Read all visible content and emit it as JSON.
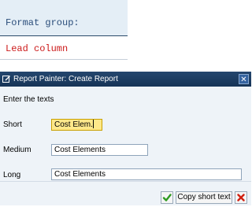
{
  "format_panel": {
    "format_group_label": "Format group:",
    "lead_column_text": "Lead column"
  },
  "dialog": {
    "title": "Report Painter: Create Report",
    "close_glyph": "✕",
    "intro": "Enter the texts",
    "fields": {
      "short": {
        "label": "Short",
        "value": "Cost Elem."
      },
      "medium": {
        "label": "Medium",
        "value": "Cost Elements"
      },
      "long": {
        "label": "Long",
        "value": "Cost Elements"
      }
    },
    "buttons": {
      "confirm_icon": "check-icon",
      "copy_short_text": "Copy short text",
      "cancel_icon": "cancel-x-icon"
    }
  },
  "colors": {
    "title_bar": "#1c3d63",
    "lead_column_text": "#cc1a1a",
    "focused_field": "#ffe88a"
  }
}
